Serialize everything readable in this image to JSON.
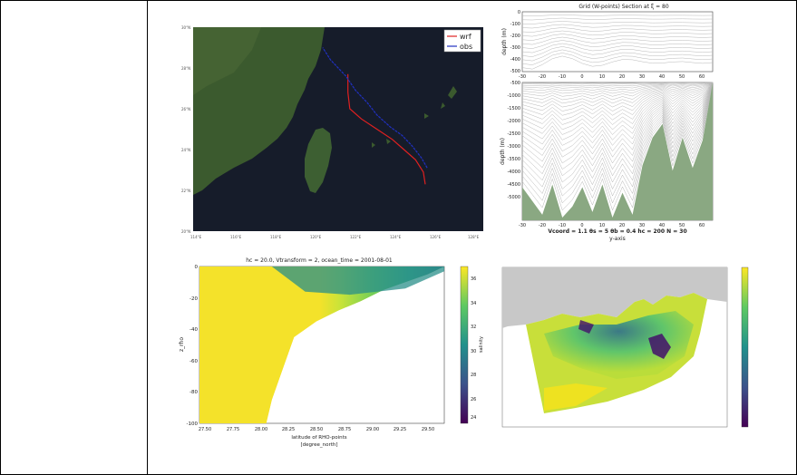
{
  "map_panel": {
    "legend": [
      "wrf",
      "obs"
    ],
    "colors": {
      "wrf": "#e02020",
      "obs": "#2030c0",
      "sea": "#161c2a",
      "land": "#3b5a2e"
    },
    "lat_ticks": [
      "30°N",
      "28°N",
      "26°N",
      "24°N",
      "22°N",
      "20°N"
    ],
    "lon_ticks": [
      "114°E",
      "116°E",
      "118°E",
      "120°E",
      "122°E",
      "124°E",
      "126°E",
      "128°E"
    ],
    "chart_data": {
      "type": "line",
      "xlabel": "",
      "ylabel": "",
      "series": [
        {
          "name": "wrf",
          "x": [
            125.5,
            125.4,
            125.0,
            124.4,
            123.8,
            123.0,
            122.2,
            121.6,
            121.5,
            121.5
          ],
          "y": [
            22.3,
            22.9,
            23.5,
            24.0,
            24.5,
            25.0,
            25.5,
            26.0,
            26.8,
            27.7
          ]
        },
        {
          "name": "obs",
          "x": [
            125.6,
            125.3,
            124.8,
            124.3,
            123.7,
            123.0,
            122.5,
            121.9,
            121.4,
            120.6,
            120.2
          ],
          "y": [
            23.1,
            23.6,
            24.2,
            24.7,
            25.1,
            25.7,
            26.3,
            26.9,
            27.6,
            28.4,
            29.0
          ]
        }
      ],
      "xlim": [
        113.5,
        128.5
      ],
      "ylim": [
        20,
        30
      ]
    }
  },
  "section_panel": {
    "title": "Grid (W-points) Section at  ξ = 80",
    "ylabel_top": "depth (m)",
    "ylabel_bottom": "depth (m)",
    "x_ticks": [
      "-30",
      "-20",
      "-10",
      "0",
      "10",
      "20",
      "30",
      "40",
      "50",
      "60"
    ],
    "top_y_ticks": [
      "0",
      "-100",
      "-200",
      "-300",
      "-400",
      "-500"
    ],
    "bottom_y_ticks": [
      "-500",
      "-1000",
      "-1500",
      "-2000",
      "-2500",
      "-3000",
      "-3500",
      "-4000",
      "-4500",
      "-5000"
    ],
    "footer": "Vcoord = 1.1   θs = 5   θb = 0.4   hc = 200   N = 30",
    "xlabel": "y-axis",
    "colors": {
      "bottom": "#8aa882",
      "lines": "#b8b8b8"
    },
    "chart_data": {
      "type": "area",
      "title": "Grid (W-points) Section at ξ = 80",
      "xlabel": "y-axis",
      "ylabel": "depth (m)",
      "x": [
        -30,
        -25,
        -20,
        -15,
        -10,
        -5,
        0,
        5,
        10,
        15,
        20,
        25,
        30,
        35,
        40,
        45,
        50,
        55,
        60,
        65
      ],
      "bathymetry": [
        -4300,
        -4800,
        -5300,
        -4200,
        -5400,
        -5000,
        -4300,
        -5200,
        -4200,
        -5400,
        -4500,
        -5300,
        -3500,
        -2500,
        -2000,
        -3700,
        -2500,
        -3600,
        -2600,
        -500
      ],
      "xlim": [
        -30,
        65
      ],
      "ylim": [
        -5500,
        0
      ]
    }
  },
  "salinity_panel": {
    "title": "hc = 20.0, Vtransform = 2, ocean_time = 2001-08-01",
    "ylabel": "z_rho",
    "xlabel_line1": "latitude of RHO-points",
    "xlabel_line2": "[degree_north]",
    "colorbar_label": "salinity",
    "colorbar_ticks": [
      "36",
      "34",
      "32",
      "30",
      "28",
      "26",
      "24"
    ],
    "x_ticks": [
      "27.50",
      "27.75",
      "28.00",
      "28.25",
      "28.50",
      "28.75",
      "29.00",
      "29.25",
      "29.50"
    ],
    "y_ticks": [
      "0",
      "-20",
      "-40",
      "-60",
      "-80",
      "-100"
    ],
    "chart_data": {
      "type": "heatmap",
      "title": "hc = 20.0, Vtransform = 2, ocean_time = 2001-08-01",
      "xlabel": "latitude of RHO-points [degree_north]",
      "ylabel": "z_rho",
      "xlim": [
        27.45,
        29.65
      ],
      "ylim": [
        -100,
        0
      ],
      "colorbar_range": [
        23,
        36
      ],
      "seafloor": {
        "x": [
          28.05,
          28.1,
          28.2,
          28.3,
          28.5,
          28.7,
          28.9,
          29.1,
          29.3,
          29.5,
          29.65
        ],
        "z": [
          -100,
          -85,
          -65,
          -45,
          -35,
          -28,
          -22,
          -15,
          -10,
          -5,
          0
        ]
      }
    }
  },
  "plan_panel": {
    "colorbar_ticks": [
      "",
      "",
      "",
      "",
      "",
      "",
      "",
      ""
    ],
    "colors": {
      "land": "#c8c8c8",
      "high": "#f2e21e",
      "mid": "#54c270",
      "low": "#2c6e8e",
      "lowest": "#43106a"
    }
  }
}
